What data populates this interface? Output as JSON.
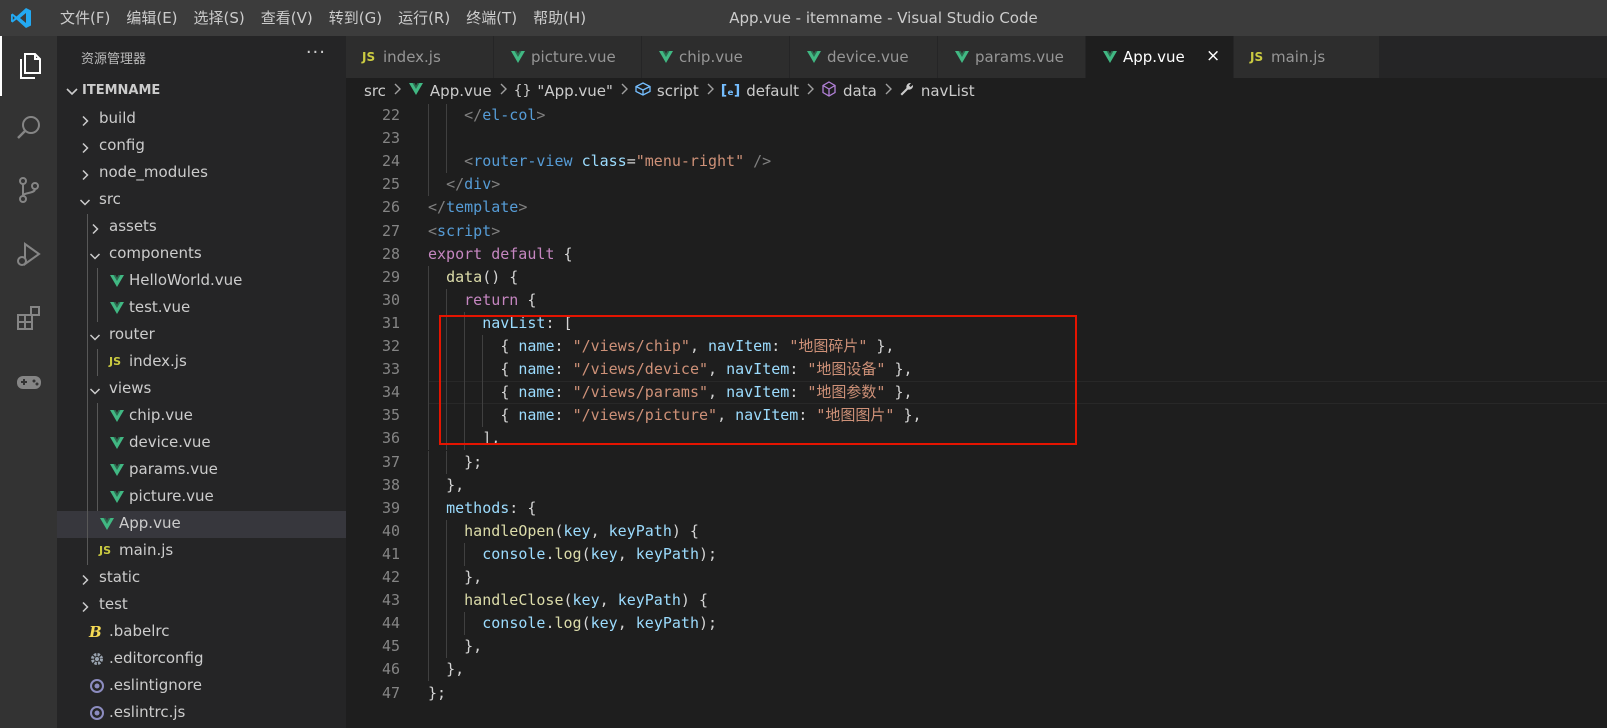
{
  "window": {
    "title": "App.vue - itemname - Visual Studio Code",
    "menus": [
      "文件(F)",
      "编辑(E)",
      "选择(S)",
      "查看(V)",
      "转到(G)",
      "运行(R)",
      "终端(T)",
      "帮助(H)"
    ]
  },
  "activity": [
    "explorer-icon",
    "search-icon",
    "source-control-icon",
    "run-debug-icon",
    "extensions-icon",
    "remote-gamepad-icon"
  ],
  "sidebar": {
    "title": "资源管理器",
    "more": "···",
    "project": "ITEMNAME",
    "tree": [
      {
        "name": "build",
        "type": "folder",
        "depth": 0,
        "open": false
      },
      {
        "name": "config",
        "type": "folder",
        "depth": 0,
        "open": false
      },
      {
        "name": "node_modules",
        "type": "folder",
        "depth": 0,
        "open": false
      },
      {
        "name": "src",
        "type": "folder",
        "depth": 0,
        "open": true
      },
      {
        "name": "assets",
        "type": "folder",
        "depth": 1,
        "open": false
      },
      {
        "name": "components",
        "type": "folder",
        "depth": 1,
        "open": true
      },
      {
        "name": "HelloWorld.vue",
        "type": "vue",
        "depth": 2
      },
      {
        "name": "test.vue",
        "type": "vue",
        "depth": 2
      },
      {
        "name": "router",
        "type": "folder",
        "depth": 1,
        "open": true
      },
      {
        "name": "index.js",
        "type": "js",
        "depth": 2
      },
      {
        "name": "views",
        "type": "folder",
        "depth": 1,
        "open": true
      },
      {
        "name": "chip.vue",
        "type": "vue",
        "depth": 2
      },
      {
        "name": "device.vue",
        "type": "vue",
        "depth": 2
      },
      {
        "name": "params.vue",
        "type": "vue",
        "depth": 2
      },
      {
        "name": "picture.vue",
        "type": "vue",
        "depth": 2
      },
      {
        "name": "App.vue",
        "type": "vue",
        "depth": 1,
        "selected": true
      },
      {
        "name": "main.js",
        "type": "js",
        "depth": 1
      },
      {
        "name": "static",
        "type": "folder",
        "depth": 0,
        "open": false
      },
      {
        "name": "test",
        "type": "folder",
        "depth": 0,
        "open": false
      },
      {
        "name": ".babelrc",
        "type": "babel",
        "depth": 0
      },
      {
        "name": ".editorconfig",
        "type": "gear",
        "depth": 0
      },
      {
        "name": ".eslintignore",
        "type": "circle",
        "depth": 0
      },
      {
        "name": ".eslintrc.js",
        "type": "circle",
        "depth": 0
      }
    ]
  },
  "tabs": [
    {
      "label": "index.js",
      "type": "js"
    },
    {
      "label": "picture.vue",
      "type": "vue"
    },
    {
      "label": "chip.vue",
      "type": "vue"
    },
    {
      "label": "device.vue",
      "type": "vue"
    },
    {
      "label": "params.vue",
      "type": "vue"
    },
    {
      "label": "App.vue",
      "type": "vue",
      "active": true,
      "close": "×"
    },
    {
      "label": "main.js",
      "type": "js"
    }
  ],
  "breadcrumb": [
    {
      "label": "src",
      "icon": ""
    },
    {
      "label": "App.vue",
      "icon": "vue"
    },
    {
      "label": "\"App.vue\"",
      "icon": "braces"
    },
    {
      "label": "script",
      "icon": "module"
    },
    {
      "label": "default",
      "icon": "bracket-var"
    },
    {
      "label": "data",
      "icon": "method"
    },
    {
      "label": "navList",
      "icon": "wrench"
    }
  ],
  "editor": {
    "first_line": 22,
    "cursor_line": 34,
    "lines": [
      {
        "indent": 2,
        "tokens": [
          [
            "t-pun",
            "</"
          ],
          [
            "t-tag",
            "el-col"
          ],
          [
            "t-pun",
            ">"
          ]
        ]
      },
      {
        "indent": 2,
        "tokens": []
      },
      {
        "indent": 2,
        "tokens": [
          [
            "t-pun",
            "<"
          ],
          [
            "t-tag",
            "router-view"
          ],
          [
            "t-d",
            " "
          ],
          [
            "t-attr",
            "class"
          ],
          [
            "t-d",
            "="
          ],
          [
            "t-str",
            "\"menu-right\""
          ],
          [
            "t-d",
            " "
          ],
          [
            "t-pun",
            "/>"
          ]
        ]
      },
      {
        "indent": 1,
        "tokens": [
          [
            "t-pun",
            "</"
          ],
          [
            "t-tag",
            "div"
          ],
          [
            "t-pun",
            ">"
          ]
        ]
      },
      {
        "indent": 0,
        "tokens": [
          [
            "t-pun",
            "</"
          ],
          [
            "t-tag",
            "template"
          ],
          [
            "t-pun",
            ">"
          ]
        ]
      },
      {
        "indent": 0,
        "tokens": [
          [
            "t-pun",
            "<"
          ],
          [
            "t-tag",
            "script"
          ],
          [
            "t-pun",
            ">"
          ]
        ]
      },
      {
        "indent": 0,
        "tokens": [
          [
            "t-kw",
            "export"
          ],
          [
            "t-d",
            " "
          ],
          [
            "t-kw",
            "default"
          ],
          [
            "t-d",
            " {"
          ]
        ]
      },
      {
        "indent": 1,
        "tokens": [
          [
            "t-fn",
            "data"
          ],
          [
            "t-d",
            "() {"
          ]
        ]
      },
      {
        "indent": 2,
        "tokens": [
          [
            "t-kw",
            "return"
          ],
          [
            "t-d",
            " {"
          ]
        ]
      },
      {
        "indent": 3,
        "tokens": [
          [
            "t-var",
            "navList"
          ],
          [
            "t-d",
            ": ["
          ]
        ]
      },
      {
        "indent": 4,
        "tokens": [
          [
            "t-d",
            "{ "
          ],
          [
            "t-var",
            "name"
          ],
          [
            "t-d",
            ": "
          ],
          [
            "t-str",
            "\"/views/chip\""
          ],
          [
            "t-d",
            ", "
          ],
          [
            "t-var",
            "navItem"
          ],
          [
            "t-d",
            ": "
          ],
          [
            "t-str",
            "\"地图碎片\""
          ],
          [
            "t-d",
            " },"
          ]
        ]
      },
      {
        "indent": 4,
        "tokens": [
          [
            "t-d",
            "{ "
          ],
          [
            "t-var",
            "name"
          ],
          [
            "t-d",
            ": "
          ],
          [
            "t-str",
            "\"/views/device\""
          ],
          [
            "t-d",
            ", "
          ],
          [
            "t-var",
            "navItem"
          ],
          [
            "t-d",
            ": "
          ],
          [
            "t-str",
            "\"地图设备\""
          ],
          [
            "t-d",
            " },"
          ]
        ]
      },
      {
        "indent": 4,
        "tokens": [
          [
            "t-d",
            "{ "
          ],
          [
            "t-var",
            "name"
          ],
          [
            "t-d",
            ": "
          ],
          [
            "t-str",
            "\"/views/params\""
          ],
          [
            "t-d",
            ", "
          ],
          [
            "t-var",
            "navItem"
          ],
          [
            "t-d",
            ": "
          ],
          [
            "t-str",
            "\"地图参数\""
          ],
          [
            "t-d",
            " },"
          ]
        ]
      },
      {
        "indent": 4,
        "tokens": [
          [
            "t-d",
            "{ "
          ],
          [
            "t-var",
            "name"
          ],
          [
            "t-d",
            ": "
          ],
          [
            "t-str",
            "\"/views/picture\""
          ],
          [
            "t-d",
            ", "
          ],
          [
            "t-var",
            "navItem"
          ],
          [
            "t-d",
            ": "
          ],
          [
            "t-str",
            "\"地图图片\""
          ],
          [
            "t-d",
            " },"
          ]
        ]
      },
      {
        "indent": 3,
        "tokens": [
          [
            "t-d",
            "],"
          ]
        ]
      },
      {
        "indent": 2,
        "tokens": [
          [
            "t-d",
            "};"
          ]
        ]
      },
      {
        "indent": 1,
        "tokens": [
          [
            "t-d",
            "},"
          ]
        ]
      },
      {
        "indent": 1,
        "tokens": [
          [
            "t-var",
            "methods"
          ],
          [
            "t-d",
            ": {"
          ]
        ]
      },
      {
        "indent": 2,
        "tokens": [
          [
            "t-fn",
            "handleOpen"
          ],
          [
            "t-d",
            "("
          ],
          [
            "t-var",
            "key"
          ],
          [
            "t-d",
            ", "
          ],
          [
            "t-var",
            "keyPath"
          ],
          [
            "t-d",
            ") {"
          ]
        ]
      },
      {
        "indent": 3,
        "tokens": [
          [
            "t-var",
            "console"
          ],
          [
            "t-d",
            "."
          ],
          [
            "t-fn",
            "log"
          ],
          [
            "t-d",
            "("
          ],
          [
            "t-var",
            "key"
          ],
          [
            "t-d",
            ", "
          ],
          [
            "t-var",
            "keyPath"
          ],
          [
            "t-d",
            ");"
          ]
        ]
      },
      {
        "indent": 2,
        "tokens": [
          [
            "t-d",
            "},"
          ]
        ]
      },
      {
        "indent": 2,
        "tokens": [
          [
            "t-fn",
            "handleClose"
          ],
          [
            "t-d",
            "("
          ],
          [
            "t-var",
            "key"
          ],
          [
            "t-d",
            ", "
          ],
          [
            "t-var",
            "keyPath"
          ],
          [
            "t-d",
            ") {"
          ]
        ]
      },
      {
        "indent": 3,
        "tokens": [
          [
            "t-var",
            "console"
          ],
          [
            "t-d",
            "."
          ],
          [
            "t-fn",
            "log"
          ],
          [
            "t-d",
            "("
          ],
          [
            "t-var",
            "key"
          ],
          [
            "t-d",
            ", "
          ],
          [
            "t-var",
            "keyPath"
          ],
          [
            "t-d",
            ");"
          ]
        ]
      },
      {
        "indent": 2,
        "tokens": [
          [
            "t-d",
            "},"
          ]
        ]
      },
      {
        "indent": 1,
        "tokens": [
          [
            "t-d",
            "},"
          ]
        ]
      },
      {
        "indent": 0,
        "tokens": [
          [
            "t-d",
            "};"
          ]
        ]
      }
    ]
  },
  "colors": {
    "accent": "#007acc",
    "highlight_box": "#e51400",
    "vue": "#41b883",
    "js": "#cbcb41"
  }
}
